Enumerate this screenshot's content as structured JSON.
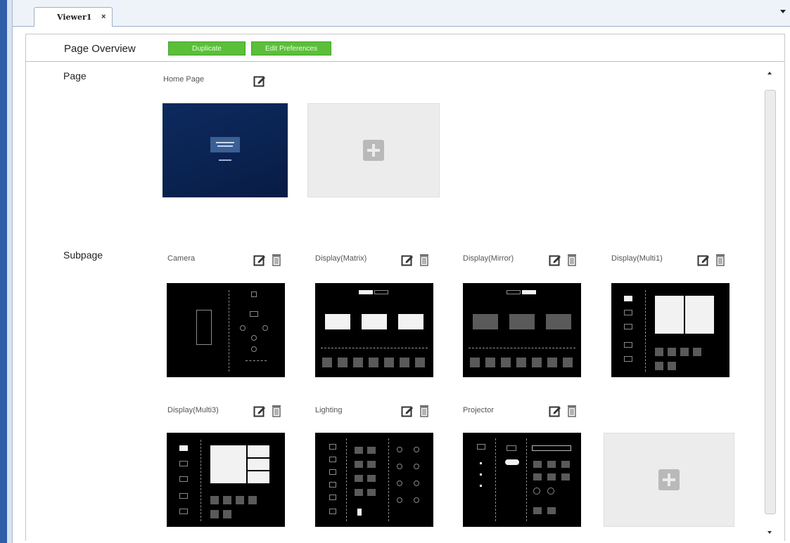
{
  "tab": {
    "label": "Viewer1",
    "close": "×"
  },
  "header": {
    "title": "Page Overview",
    "duplicate_label": "Duplicate",
    "edit_preferences_label": "Edit Preferences"
  },
  "sections": {
    "page_label": "Page",
    "subpage_label": "Subpage"
  },
  "pages": [
    {
      "title": "Home Page"
    }
  ],
  "subpages": [
    {
      "title": "Camera"
    },
    {
      "title": "Display(Matrix)"
    },
    {
      "title": "Display(Mirror)"
    },
    {
      "title": "Display(Multi1)"
    },
    {
      "title": "Display(Multi3)"
    },
    {
      "title": "Lighting"
    },
    {
      "title": "Projector"
    }
  ],
  "colors": {
    "accent_green": "#5bbf3a",
    "left_strip_blue": "#2f5fa8",
    "home_thumb_blue": "#0a2250"
  }
}
